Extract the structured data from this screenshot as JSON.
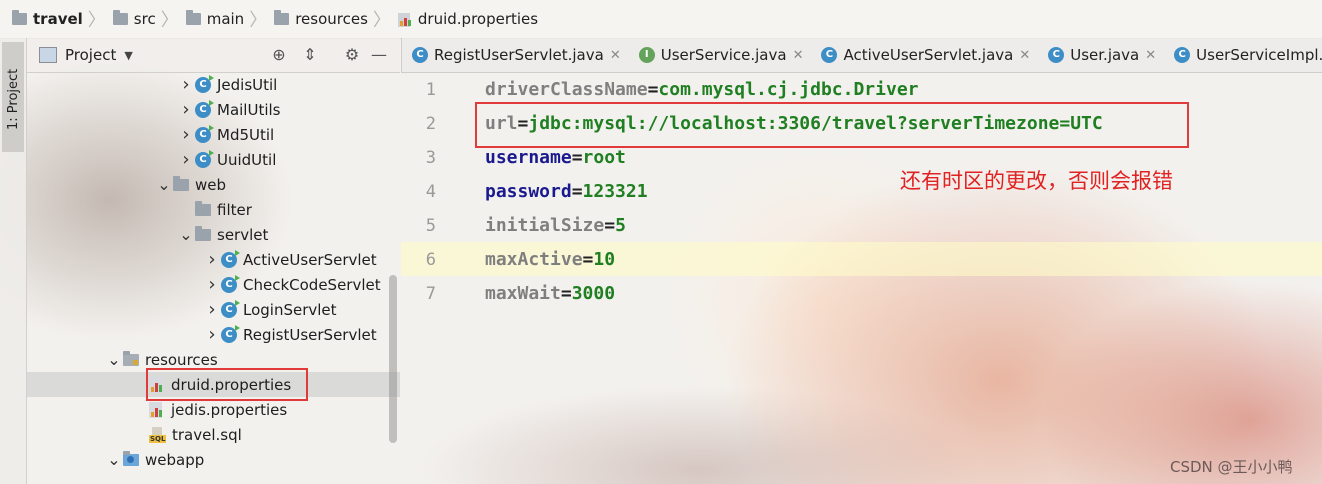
{
  "breadcrumb": [
    "travel",
    "src",
    "main",
    "resources",
    "druid.properties"
  ],
  "tool_strip": {
    "project_tab": "1: Project"
  },
  "project_panel": {
    "title": "Project",
    "tree": [
      {
        "label": "JedisUtil",
        "type": "class",
        "arrow": "right"
      },
      {
        "label": "MailUtils",
        "type": "class",
        "arrow": "right"
      },
      {
        "label": "Md5Util",
        "type": "class",
        "arrow": "right"
      },
      {
        "label": "UuidUtil",
        "type": "class",
        "arrow": "right"
      },
      {
        "label": "web",
        "type": "package",
        "arrow": "down"
      },
      {
        "label": "filter",
        "type": "package",
        "arrow": ""
      },
      {
        "label": "servlet",
        "type": "package",
        "arrow": "down"
      },
      {
        "label": "ActiveUserServlet",
        "type": "class",
        "arrow": "right"
      },
      {
        "label": "CheckCodeServlet",
        "type": "class",
        "arrow": "right"
      },
      {
        "label": "LoginServlet",
        "type": "class",
        "arrow": "right"
      },
      {
        "label": "RegistUserServlet",
        "type": "class",
        "arrow": "right"
      },
      {
        "label": "resources",
        "type": "resources",
        "arrow": "down"
      },
      {
        "label": "druid.properties",
        "type": "properties",
        "arrow": "",
        "selected": true
      },
      {
        "label": "jedis.properties",
        "type": "properties",
        "arrow": ""
      },
      {
        "label": "travel.sql",
        "type": "sql",
        "arrow": ""
      },
      {
        "label": "webapp",
        "type": "web",
        "arrow": "down"
      }
    ]
  },
  "editor_tabs": [
    {
      "label": "RegistUserServlet.java",
      "icon": "class-icon"
    },
    {
      "label": "UserService.java",
      "icon": "interface-icon"
    },
    {
      "label": "ActiveUserServlet.java",
      "icon": "class-icon"
    },
    {
      "label": "User.java",
      "icon": "class-icon"
    },
    {
      "label": "UserServiceImpl.java",
      "icon": "class-icon"
    }
  ],
  "code_lines": [
    {
      "num": "1",
      "key": "driverClassName",
      "value": "com.mysql.cj.jdbc.Driver",
      "muted": true
    },
    {
      "num": "2",
      "key": "url",
      "value": "jdbc:mysql://localhost:3306/travel?serverTimezone=UTC",
      "muted": true
    },
    {
      "num": "3",
      "key": "username",
      "value": "root",
      "muted": false
    },
    {
      "num": "4",
      "key": "password",
      "value": "123321",
      "muted": false
    },
    {
      "num": "5",
      "key": "initialSize",
      "value": "5",
      "muted": true
    },
    {
      "num": "6",
      "key": "maxActive",
      "value": "10",
      "muted": true
    },
    {
      "num": "7",
      "key": "maxWait",
      "value": "3000",
      "muted": true
    }
  ],
  "annotation": "还有时区的更改，否则会报错",
  "watermark": "CSDN @王小小鸭",
  "colors": {
    "highlight_box": "#e03a3a",
    "annotation": "#e02222",
    "key": "#1a1a8e",
    "value": "#1f7f21"
  }
}
